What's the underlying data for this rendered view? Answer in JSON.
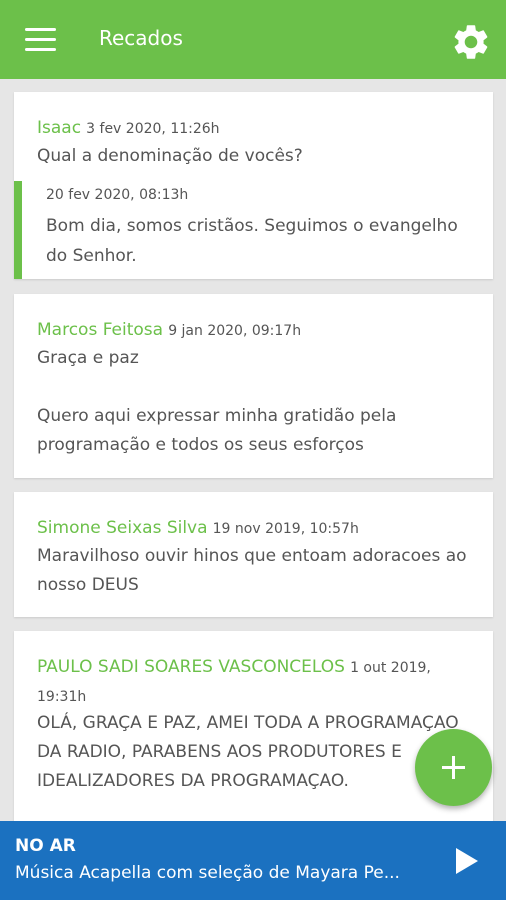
{
  "header": {
    "title": "Recados",
    "menu_icon": "hamburger-menu-icon",
    "settings_icon": "gear-icon"
  },
  "messages": [
    {
      "author": "Isaac",
      "date": "3 fev 2020, 11:26h",
      "body": "Qual a denominação de vocês?",
      "reply": {
        "date": "20 fev 2020, 08:13h",
        "body": "Bom dia, somos cristãos. Seguimos o evangelho do Senhor."
      }
    },
    {
      "author": "Marcos Feitosa",
      "date": "9 jan 2020, 09:17h",
      "body": "Graça e paz\n\nQuero aqui expressar minha gratidão pela programação e todos os seus esforços"
    },
    {
      "author": "Simone Seixas Silva",
      "date": "19 nov 2019, 10:57h",
      "body": "Maravilhoso ouvir hinos que entoam adoracoes ao nosso DEUS"
    },
    {
      "author": "PAULO SADI SOARES VASCONCELOS",
      "date": "1 out 2019, 19:31h",
      "body": "OLÁ, GRAÇA E PAZ, AMEI TODA A PROGRAMAÇAO DA RADIO, PARABENS AOS PRODUTORES E IDEALIZADORES DA PROGRAMAÇAO."
    }
  ],
  "fab": {
    "icon": "plus-icon"
  },
  "player": {
    "status": "NO AR",
    "track": "Música Acapella com seleção de Mayara Pe...",
    "play_icon": "play-icon"
  },
  "colors": {
    "accent": "#6cc04a",
    "player_bg": "#1b71c0",
    "background": "#e6e6e6",
    "text": "#555555"
  }
}
